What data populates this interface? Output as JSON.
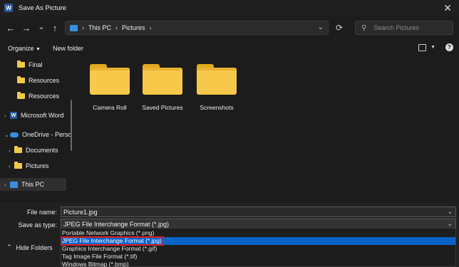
{
  "window": {
    "title": "Save As Picture",
    "app_icon_letter": "W"
  },
  "nav": {
    "back": "←",
    "forward": "→",
    "recent": "⌄",
    "up": "↑",
    "breadcrumbs": [
      "This PC",
      "Pictures"
    ],
    "refresh": "⟳",
    "search_placeholder": "Search Pictures"
  },
  "toolbar": {
    "organize": "Organize",
    "new_folder": "New folder"
  },
  "sidebar": {
    "items": [
      {
        "label": "Final",
        "type": "folder"
      },
      {
        "label": "Resources",
        "type": "folder"
      },
      {
        "label": "Resources",
        "type": "folder"
      },
      {
        "label": "Microsoft Word",
        "type": "word"
      },
      {
        "label": "OneDrive - Perso",
        "type": "cloud"
      },
      {
        "label": "Documents",
        "type": "folder"
      },
      {
        "label": "Pictures",
        "type": "folder"
      },
      {
        "label": "This PC",
        "type": "pc"
      }
    ]
  },
  "content": {
    "folders": [
      "Camera Roll",
      "Saved Pictures",
      "Screenshots"
    ]
  },
  "form": {
    "filename_label": "File name:",
    "filename_value": "Picture1.jpg",
    "savetype_label": "Save as type:",
    "savetype_value": "JPEG File Interchange Format (*.jpg)",
    "options": [
      "Portable Network Graphics (*.png)",
      "JPEG File Interchange Format (*.jpg)",
      "Graphics Interchange Format (*.gif)",
      "Tag Image File Format (*.tif)",
      "Windows Bitmap (*.bmp)"
    ],
    "selected_option_index": 1,
    "hide_folders": "Hide Folders"
  },
  "colors": {
    "accent": "#0a64c8",
    "highlight_border": "#d8202a",
    "folder": "#f7c84a"
  }
}
